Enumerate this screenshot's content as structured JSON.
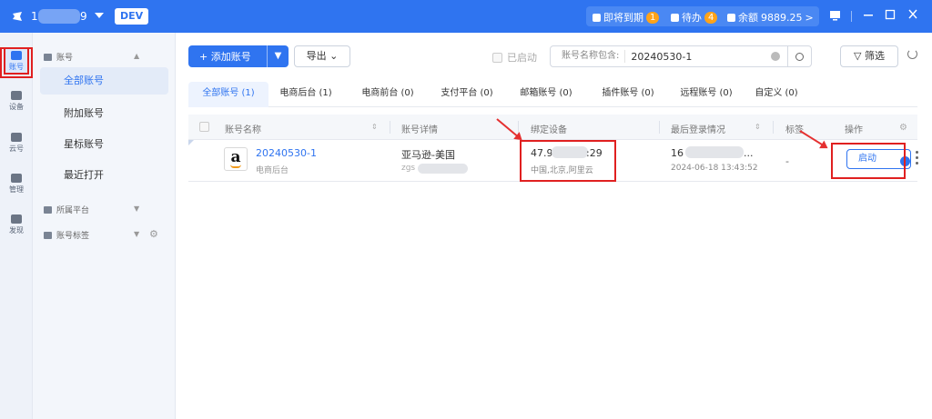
{
  "topbar": {
    "account_prefix": "1",
    "account_suffix": "9",
    "env_badge": "DEV",
    "expiring_label": "即将到期",
    "expiring_count": "1",
    "todo_label": "待办",
    "todo_count": "4",
    "balance_label": "余额",
    "balance_value": "9889.25",
    "balance_chevron": ">"
  },
  "iconnav": [
    {
      "label": "账号"
    },
    {
      "label": "设备"
    },
    {
      "label": "云号"
    },
    {
      "label": "管理"
    },
    {
      "label": "发现"
    }
  ],
  "sidenav": {
    "group_account": "账号",
    "items": [
      {
        "label": "全部账号"
      },
      {
        "label": "附加账号"
      },
      {
        "label": "星标账号"
      },
      {
        "label": "最近打开"
      }
    ],
    "group_platform": "所属平台",
    "group_tags": "账号标签"
  },
  "toolbar": {
    "add_label": "添加账号",
    "export_label": "导出",
    "started_label": "已启动",
    "search_prefix": "账号名称包含:",
    "search_value": "20240530-1",
    "filter_label": "筛选"
  },
  "tabs": [
    {
      "label": "全部账号 (1)"
    },
    {
      "label": "电商后台 (1)"
    },
    {
      "label": "电商前台 (0)"
    },
    {
      "label": "支付平台 (0)"
    },
    {
      "label": "邮箱账号 (0)"
    },
    {
      "label": "插件账号 (0)"
    },
    {
      "label": "远程账号 (0)"
    },
    {
      "label": "自定义 (0)"
    }
  ],
  "table": {
    "headers": [
      "账号名称",
      "账号详情",
      "绑定设备",
      "最后登录情况",
      "标签",
      "操作"
    ],
    "rows": [
      {
        "name": "20240530-1",
        "type": "电商后台",
        "detail": "亚马逊-美国",
        "detail_sub": "zgs",
        "device_ip_a": "47.9",
        "device_ip_b": ":29",
        "device_location": "中国,北京,阿里云",
        "login_a": "16",
        "login_ellipsis": "...",
        "login_time": "2024-06-18 13:43:52",
        "tag": "-",
        "action": "启动"
      }
    ]
  }
}
